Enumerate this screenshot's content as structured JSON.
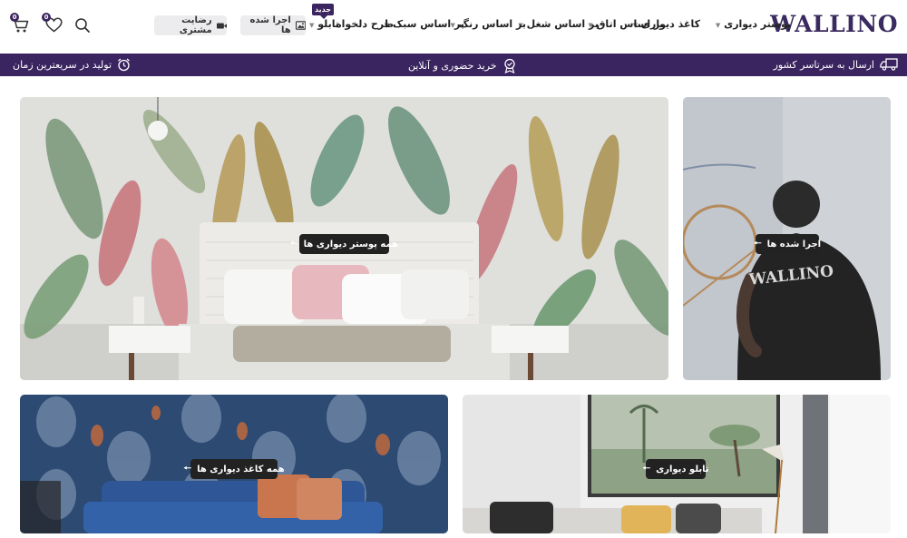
{
  "header": {
    "logo": "WALLINO",
    "nav": [
      {
        "label": "پوستر دیواری"
      },
      {
        "label": "کاغذ دیواری"
      },
      {
        "label": "بر اساس اتاق"
      },
      {
        "label": "بر اساس شغل"
      },
      {
        "label": "بر اساس رنگ"
      },
      {
        "label": "بر اساس سبک"
      },
      {
        "label": "طرح دلخواه"
      },
      {
        "label": "تابلو"
      }
    ],
    "new_badge": "جدید",
    "executed_button": "اجرا شده ها",
    "satisfaction_button": "رضایت مشتری",
    "wishlist_count": "0",
    "cart_count": "0"
  },
  "infobar": {
    "shipping": "ارسال به سرتاسر کشور",
    "purchase": "خرید حضوری و آنلاین",
    "production": "تولید در سریعترین زمان"
  },
  "categories": {
    "posters": "همه پوستر دیواری ها",
    "executed": "اجرا شده ها",
    "wallpapers": "همه کاغذ دیواری ها",
    "paintings": "تابلو دیواری"
  },
  "images": {
    "worker_shirt_text": "WALLINO"
  },
  "colors": {
    "brand_purple": "#3b2560",
    "label_dark": "#222222",
    "pill_gray": "#ececef"
  }
}
